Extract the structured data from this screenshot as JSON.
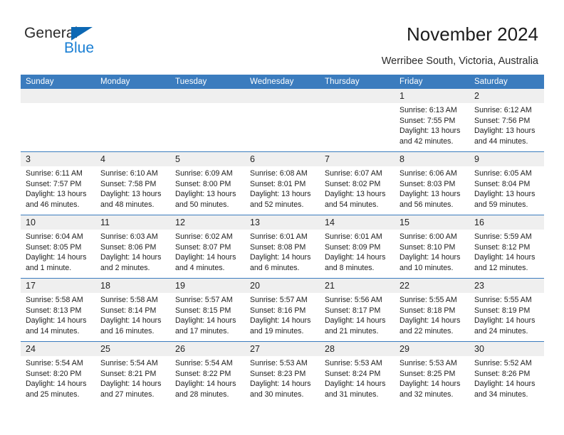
{
  "brand": {
    "name_part1": "General",
    "name_part2": "Blue",
    "triangle_color": "#0c68b4",
    "blue_text_color": "#1a7fd4"
  },
  "header": {
    "title": "November 2024",
    "subtitle": "Werribee South, Victoria, Australia"
  },
  "theme": {
    "header_blue": "#3b7cbe",
    "daynum_band": "#efefef",
    "text": "#1d1d1d"
  },
  "calendar": {
    "weekday_headers": [
      "Sunday",
      "Monday",
      "Tuesday",
      "Wednesday",
      "Thursday",
      "Friday",
      "Saturday"
    ],
    "weeks": [
      {
        "days": [
          {
            "num": "",
            "sunrise": "",
            "sunset": "",
            "daylight": ""
          },
          {
            "num": "",
            "sunrise": "",
            "sunset": "",
            "daylight": ""
          },
          {
            "num": "",
            "sunrise": "",
            "sunset": "",
            "daylight": ""
          },
          {
            "num": "",
            "sunrise": "",
            "sunset": "",
            "daylight": ""
          },
          {
            "num": "",
            "sunrise": "",
            "sunset": "",
            "daylight": ""
          },
          {
            "num": "1",
            "sunrise": "Sunrise: 6:13 AM",
            "sunset": "Sunset: 7:55 PM",
            "daylight": "Daylight: 13 hours and 42 minutes."
          },
          {
            "num": "2",
            "sunrise": "Sunrise: 6:12 AM",
            "sunset": "Sunset: 7:56 PM",
            "daylight": "Daylight: 13 hours and 44 minutes."
          }
        ]
      },
      {
        "days": [
          {
            "num": "3",
            "sunrise": "Sunrise: 6:11 AM",
            "sunset": "Sunset: 7:57 PM",
            "daylight": "Daylight: 13 hours and 46 minutes."
          },
          {
            "num": "4",
            "sunrise": "Sunrise: 6:10 AM",
            "sunset": "Sunset: 7:58 PM",
            "daylight": "Daylight: 13 hours and 48 minutes."
          },
          {
            "num": "5",
            "sunrise": "Sunrise: 6:09 AM",
            "sunset": "Sunset: 8:00 PM",
            "daylight": "Daylight: 13 hours and 50 minutes."
          },
          {
            "num": "6",
            "sunrise": "Sunrise: 6:08 AM",
            "sunset": "Sunset: 8:01 PM",
            "daylight": "Daylight: 13 hours and 52 minutes."
          },
          {
            "num": "7",
            "sunrise": "Sunrise: 6:07 AM",
            "sunset": "Sunset: 8:02 PM",
            "daylight": "Daylight: 13 hours and 54 minutes."
          },
          {
            "num": "8",
            "sunrise": "Sunrise: 6:06 AM",
            "sunset": "Sunset: 8:03 PM",
            "daylight": "Daylight: 13 hours and 56 minutes."
          },
          {
            "num": "9",
            "sunrise": "Sunrise: 6:05 AM",
            "sunset": "Sunset: 8:04 PM",
            "daylight": "Daylight: 13 hours and 59 minutes."
          }
        ]
      },
      {
        "days": [
          {
            "num": "10",
            "sunrise": "Sunrise: 6:04 AM",
            "sunset": "Sunset: 8:05 PM",
            "daylight": "Daylight: 14 hours and 1 minute."
          },
          {
            "num": "11",
            "sunrise": "Sunrise: 6:03 AM",
            "sunset": "Sunset: 8:06 PM",
            "daylight": "Daylight: 14 hours and 2 minutes."
          },
          {
            "num": "12",
            "sunrise": "Sunrise: 6:02 AM",
            "sunset": "Sunset: 8:07 PM",
            "daylight": "Daylight: 14 hours and 4 minutes."
          },
          {
            "num": "13",
            "sunrise": "Sunrise: 6:01 AM",
            "sunset": "Sunset: 8:08 PM",
            "daylight": "Daylight: 14 hours and 6 minutes."
          },
          {
            "num": "14",
            "sunrise": "Sunrise: 6:01 AM",
            "sunset": "Sunset: 8:09 PM",
            "daylight": "Daylight: 14 hours and 8 minutes."
          },
          {
            "num": "15",
            "sunrise": "Sunrise: 6:00 AM",
            "sunset": "Sunset: 8:10 PM",
            "daylight": "Daylight: 14 hours and 10 minutes."
          },
          {
            "num": "16",
            "sunrise": "Sunrise: 5:59 AM",
            "sunset": "Sunset: 8:12 PM",
            "daylight": "Daylight: 14 hours and 12 minutes."
          }
        ]
      },
      {
        "days": [
          {
            "num": "17",
            "sunrise": "Sunrise: 5:58 AM",
            "sunset": "Sunset: 8:13 PM",
            "daylight": "Daylight: 14 hours and 14 minutes."
          },
          {
            "num": "18",
            "sunrise": "Sunrise: 5:58 AM",
            "sunset": "Sunset: 8:14 PM",
            "daylight": "Daylight: 14 hours and 16 minutes."
          },
          {
            "num": "19",
            "sunrise": "Sunrise: 5:57 AM",
            "sunset": "Sunset: 8:15 PM",
            "daylight": "Daylight: 14 hours and 17 minutes."
          },
          {
            "num": "20",
            "sunrise": "Sunrise: 5:57 AM",
            "sunset": "Sunset: 8:16 PM",
            "daylight": "Daylight: 14 hours and 19 minutes."
          },
          {
            "num": "21",
            "sunrise": "Sunrise: 5:56 AM",
            "sunset": "Sunset: 8:17 PM",
            "daylight": "Daylight: 14 hours and 21 minutes."
          },
          {
            "num": "22",
            "sunrise": "Sunrise: 5:55 AM",
            "sunset": "Sunset: 8:18 PM",
            "daylight": "Daylight: 14 hours and 22 minutes."
          },
          {
            "num": "23",
            "sunrise": "Sunrise: 5:55 AM",
            "sunset": "Sunset: 8:19 PM",
            "daylight": "Daylight: 14 hours and 24 minutes."
          }
        ]
      },
      {
        "days": [
          {
            "num": "24",
            "sunrise": "Sunrise: 5:54 AM",
            "sunset": "Sunset: 8:20 PM",
            "daylight": "Daylight: 14 hours and 25 minutes."
          },
          {
            "num": "25",
            "sunrise": "Sunrise: 5:54 AM",
            "sunset": "Sunset: 8:21 PM",
            "daylight": "Daylight: 14 hours and 27 minutes."
          },
          {
            "num": "26",
            "sunrise": "Sunrise: 5:54 AM",
            "sunset": "Sunset: 8:22 PM",
            "daylight": "Daylight: 14 hours and 28 minutes."
          },
          {
            "num": "27",
            "sunrise": "Sunrise: 5:53 AM",
            "sunset": "Sunset: 8:23 PM",
            "daylight": "Daylight: 14 hours and 30 minutes."
          },
          {
            "num": "28",
            "sunrise": "Sunrise: 5:53 AM",
            "sunset": "Sunset: 8:24 PM",
            "daylight": "Daylight: 14 hours and 31 minutes."
          },
          {
            "num": "29",
            "sunrise": "Sunrise: 5:53 AM",
            "sunset": "Sunset: 8:25 PM",
            "daylight": "Daylight: 14 hours and 32 minutes."
          },
          {
            "num": "30",
            "sunrise": "Sunrise: 5:52 AM",
            "sunset": "Sunset: 8:26 PM",
            "daylight": "Daylight: 14 hours and 34 minutes."
          }
        ]
      }
    ]
  }
}
